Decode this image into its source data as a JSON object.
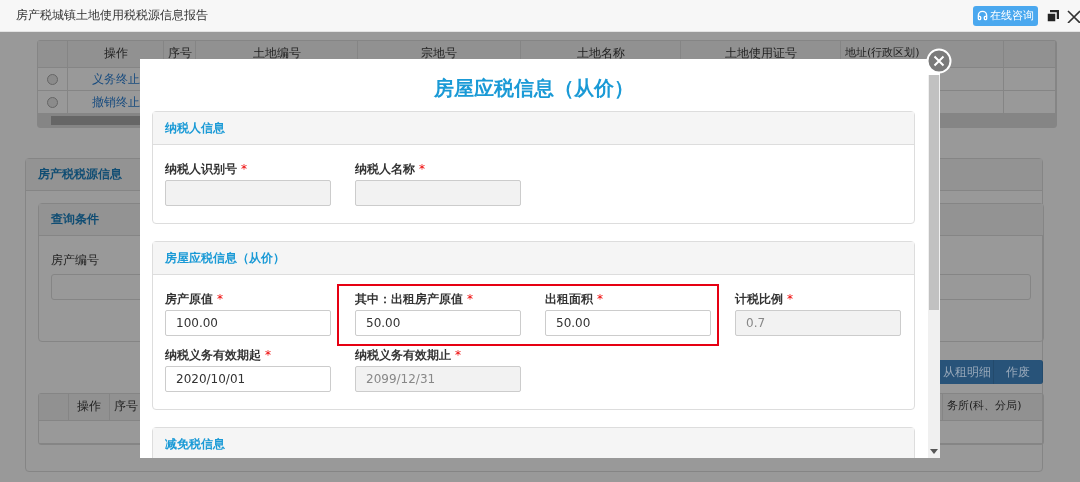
{
  "window": {
    "title": "房产税城镇土地使用税税源信息报告",
    "consult_button": "在线咨询"
  },
  "land_table": {
    "columns": [
      "操作",
      "序号",
      "土地编号",
      "宗地号",
      "土地名称",
      "土地使用证号",
      "地址(行政区划)"
    ],
    "rows": [
      {
        "action": "义务终止",
        "selected": false
      },
      {
        "action": "撤销终止",
        "selected": false
      }
    ]
  },
  "source_section": {
    "title": "房产税税源信息",
    "query_title": "查询条件",
    "field_label": "房产编号",
    "buttons": [
      "从租明细",
      "作废"
    ],
    "table_columns": [
      "操作",
      "序号",
      "务所(科、分局)"
    ]
  },
  "dialog": {
    "title": "房屋应税信息（从价）",
    "panels": [
      {
        "title": "纳税人信息",
        "rows": [
          [
            {
              "kind": "field",
              "label": "纳税人识别号",
              "mark": "*",
              "disabled": true
            },
            {
              "kind": "field",
              "label": "纳税人名称",
              "mark": "*",
              "disabled": true
            }
          ]
        ]
      },
      {
        "title": "房屋应税信息（从价）",
        "rows": [
          [
            {
              "kind": "field",
              "label": "房产原值",
              "mark": "*",
              "value": "100.00",
              "disabled": false
            },
            {
              "kind": "highlight",
              "fields": [
                {
                  "kind": "field",
                  "label": "其中：出租房产原值",
                  "mark": "*",
                  "value": "50.00",
                  "disabled": false
                },
                {
                  "kind": "field",
                  "label": "出租面积",
                  "mark": "*",
                  "value": "50.00",
                  "disabled": false
                }
              ]
            },
            {
              "kind": "field",
              "label": "计税比例",
              "mark": "*",
              "value": "0.7",
              "disabled": true
            }
          ],
          [
            {
              "kind": "field",
              "label": "纳税义务有效期起",
              "mark": "*",
              "value": "2020/10/01",
              "disabled": false
            },
            {
              "kind": "field",
              "label": "纳税义务有效期止",
              "mark": "*",
              "value": "2099/12/31",
              "disabled": true
            }
          ]
        ]
      },
      {
        "title": "减免税信息"
      }
    ]
  }
}
